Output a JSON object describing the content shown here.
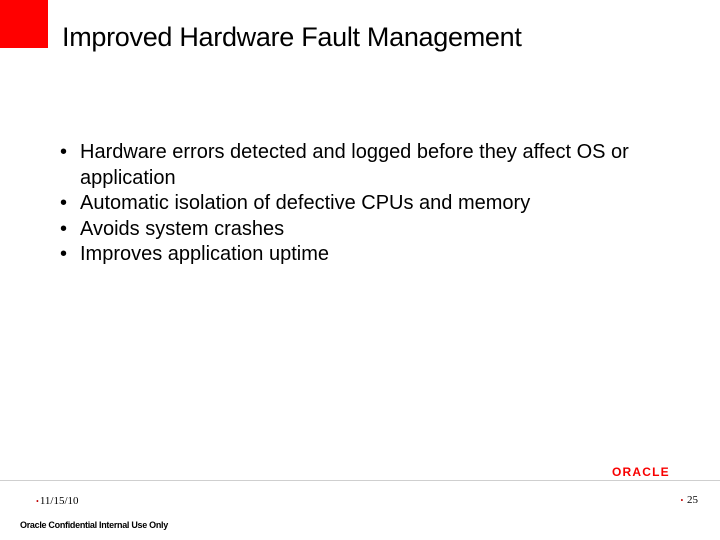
{
  "slide": {
    "title": "Improved Hardware Fault Management",
    "bullets": [
      "Hardware errors detected and logged before they affect OS or application",
      "Automatic isolation of defective CPUs and memory",
      "Avoids system crashes",
      "Improves application uptime"
    ]
  },
  "footer": {
    "date": "11/15/10",
    "confidentiality": "Oracle Confidential Internal Use Only",
    "page_number": "25",
    "logo_text": "ORACLE"
  },
  "colors": {
    "accent_red": "#ff0000",
    "oracle_red": "#f80000"
  }
}
